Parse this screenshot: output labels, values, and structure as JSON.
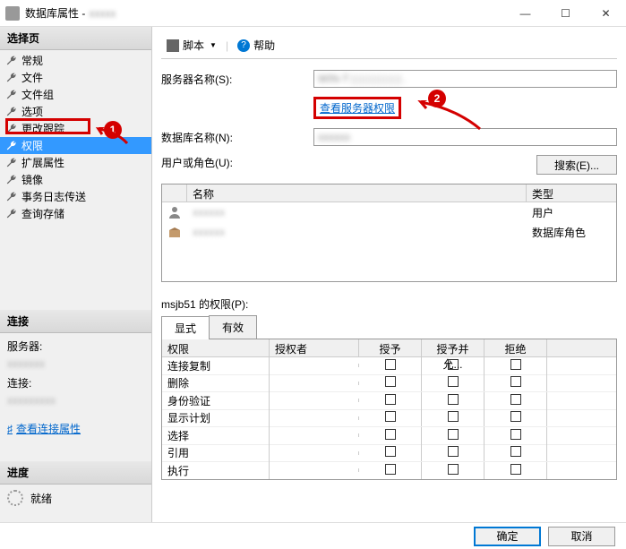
{
  "window": {
    "title": "数据库属性 -",
    "title_blur": "xxxxx"
  },
  "winbtns": {
    "min": "—",
    "max": "☐",
    "close": "✕"
  },
  "panels": {
    "select": "选择页",
    "connection": "连接",
    "progress": "进度"
  },
  "nav": [
    "常规",
    "文件",
    "文件组",
    "选项",
    "更改跟踪",
    "权限",
    "扩展属性",
    "镜像",
    "事务日志传送",
    "查询存储"
  ],
  "nav_selected_index": 5,
  "conn": {
    "server_label": "服务器:",
    "server_blur": "xxxxxxx",
    "conn_label": "连接:",
    "conn_blur": "xxxxxxxxx",
    "view_link": "查看连接属性"
  },
  "progress": {
    "ready": "就绪"
  },
  "toolbar": {
    "script": "脚本",
    "help": "帮助"
  },
  "form": {
    "server_name": "服务器名称(S):",
    "server_value": "WIN-T | | | | | | | | | .",
    "view_server_perms": "查看服务器权限",
    "db_name": "数据库名称(N):",
    "db_value": "xxxxxx",
    "user_role": "用户或角色(U):",
    "search_btn": "搜索(E)..."
  },
  "user_table": {
    "headers": {
      "name": "名称",
      "type": "类型"
    },
    "rows": [
      {
        "icon": "person",
        "name": "",
        "type": "用户"
      },
      {
        "icon": "group",
        "name": "",
        "type": "数据库角色"
      }
    ]
  },
  "perm_section": {
    "title": "msjb51 的权限(P):"
  },
  "tabs": {
    "explicit": "显式",
    "effective": "有效"
  },
  "perm_headers": {
    "perm": "权限",
    "grantor": "授权者",
    "grant": "授予",
    "with_grant": "授予并允...",
    "deny": "拒绝"
  },
  "perm_rows": [
    "连接复制",
    "删除",
    "身份验证",
    "显示计划",
    "选择",
    "引用",
    "执行"
  ],
  "footer": {
    "ok": "确定",
    "cancel": "取消"
  },
  "annotations": {
    "1": "1",
    "2": "2"
  }
}
